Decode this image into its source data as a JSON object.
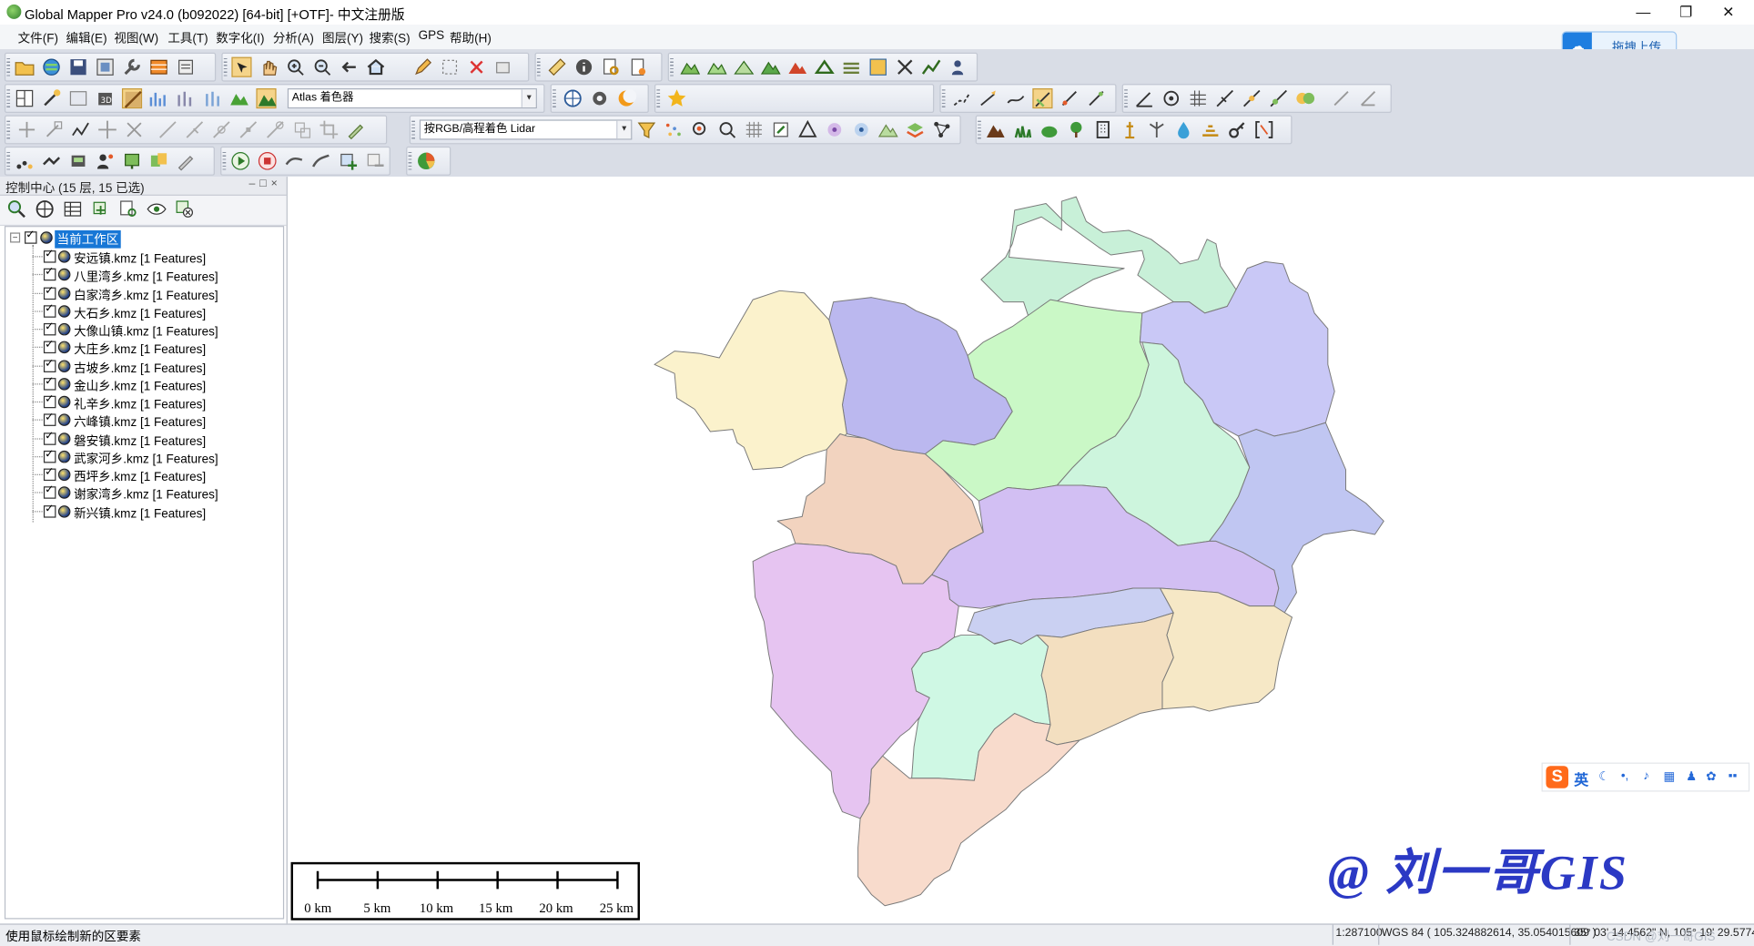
{
  "window": {
    "title": "Global Mapper Pro v24.0 (b092022) [64-bit] [+OTF]- 中文注册版",
    "minimize": "—",
    "maximize": "❐",
    "close": "✕"
  },
  "menu": [
    "文件(F)",
    "编辑(E)",
    "视图(W)",
    "工具(T)",
    "数字化(I)",
    "分析(A)",
    "图层(Y)",
    "搜索(S)",
    "GPS",
    "帮助(H)"
  ],
  "upload_button": {
    "label": "拖拽上传",
    "icon": "cloud-icon"
  },
  "toolbar": {
    "shader_combo": "Atlas 着色器",
    "lidar_combo": "按RGB/高程着色 Lidar"
  },
  "control_center": {
    "title": "控制中心 (15 层, 15 已选)",
    "window_controls": "–□×",
    "root": "当前工作区",
    "layers": [
      "安远镇.kmz [1 Features]",
      "八里湾乡.kmz [1 Features]",
      "白家湾乡.kmz [1 Features]",
      "大石乡.kmz [1 Features]",
      "大像山镇.kmz [1 Features]",
      "大庄乡.kmz [1 Features]",
      "古坡乡.kmz [1 Features]",
      "金山乡.kmz [1 Features]",
      "礼辛乡.kmz [1 Features]",
      "六峰镇.kmz [1 Features]",
      "磐安镇.kmz [1 Features]",
      "武家河乡.kmz [1 Features]",
      "西坪乡.kmz [1 Features]",
      "谢家湾乡.kmz [1 Features]",
      "新兴镇.kmz [1 Features]"
    ]
  },
  "map": {
    "scale_labels": [
      "0 km",
      "5 km",
      "10 km",
      "15 km",
      "20 km",
      "25 km"
    ],
    "watermark": "@ 刘一哥GIS",
    "ime": {
      "logo": "S",
      "mode": "英"
    },
    "region_colors": [
      "#c8f0d8",
      "#bbb8ef",
      "#fbf2cc",
      "#caf8c6",
      "#c9c8f6",
      "#cdf5dd",
      "#c0c6f2",
      "#f2d3bf",
      "#d2bff3",
      "#e6c4f1",
      "#cad0f2",
      "#f6e8c6",
      "#cff8e4",
      "#f3dfc0",
      "#f8dbcc"
    ]
  },
  "status": {
    "message": "使用鼠标绘制新的区要素",
    "scale": "1:287100",
    "coords": "WGS 84 ( 105.324882614, 35.054015609 )",
    "dms": "35° 03' 14.4562\" N, 105° 19' 29.5774\" E",
    "credit": "CSDN @刘一哥GIS"
  }
}
